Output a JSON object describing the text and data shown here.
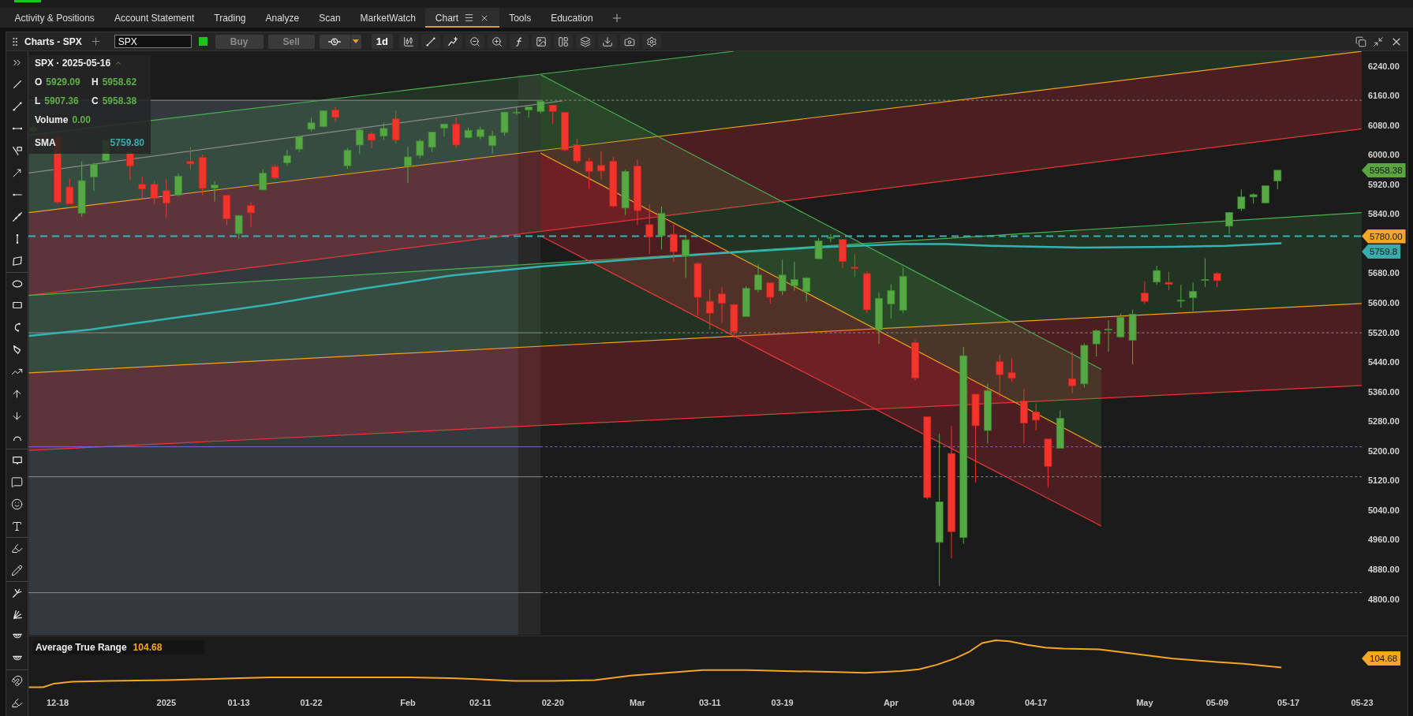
{
  "nav_tabs": [
    {
      "label": "Activity & Positions",
      "selected": false
    },
    {
      "label": "Account Statement",
      "selected": false
    },
    {
      "label": "Trading",
      "selected": false
    },
    {
      "label": "Analyze",
      "selected": false
    },
    {
      "label": "Scan",
      "selected": false
    },
    {
      "label": "MarketWatch",
      "selected": false
    },
    {
      "label": "Chart",
      "selected": true
    },
    {
      "label": "Tools",
      "selected": false
    },
    {
      "label": "Education",
      "selected": false
    }
  ],
  "chart_toolbar": {
    "title": "Charts - SPX",
    "symbol": "SPX",
    "trade_buttons": [
      {
        "label": "Buy",
        "disabled": true
      },
      {
        "label": "Sell",
        "disabled": true
      }
    ],
    "interval": "1d"
  },
  "legend": {
    "title": "SPX · 2025-05-16",
    "quotes": [
      {
        "key": "O",
        "value": "5929.09"
      },
      {
        "key": "H",
        "value": "5958.62"
      },
      {
        "key": "L",
        "value": "5907.36"
      },
      {
        "key": "C",
        "value": "5958.38"
      }
    ],
    "volume": {
      "label": "Volume",
      "value": "0.00"
    },
    "study": {
      "label": "SMA",
      "value": "5759.80"
    }
  },
  "price_axis": {
    "ticks": [
      "6240.00",
      "6160.00",
      "6080.00",
      "6000.00",
      "5920.00",
      "5840.00",
      "5680.00",
      "5600.00",
      "5520.00",
      "5440.00",
      "5360.00",
      "5280.00",
      "5200.00",
      "5120.00",
      "5040.00",
      "4960.00",
      "4880.00",
      "4800.00"
    ]
  },
  "price_badges": [
    {
      "kind": "last",
      "text": "5958.38"
    },
    {
      "kind": "alert",
      "text": "5780.00"
    },
    {
      "kind": "sma",
      "text": "5759.8"
    }
  ],
  "atr_pane": {
    "label": "Average True Range",
    "value": "104.68",
    "badge": "104.68"
  },
  "date_axis": {
    "ticks": [
      "12-18",
      "2025",
      "01-13",
      "01-22",
      "Feb",
      "02-11",
      "02-20",
      "Mar",
      "03-11",
      "03-19",
      "Apr",
      "04-09",
      "04-17",
      "May",
      "05-09",
      "05-17",
      "05-23"
    ]
  }
}
